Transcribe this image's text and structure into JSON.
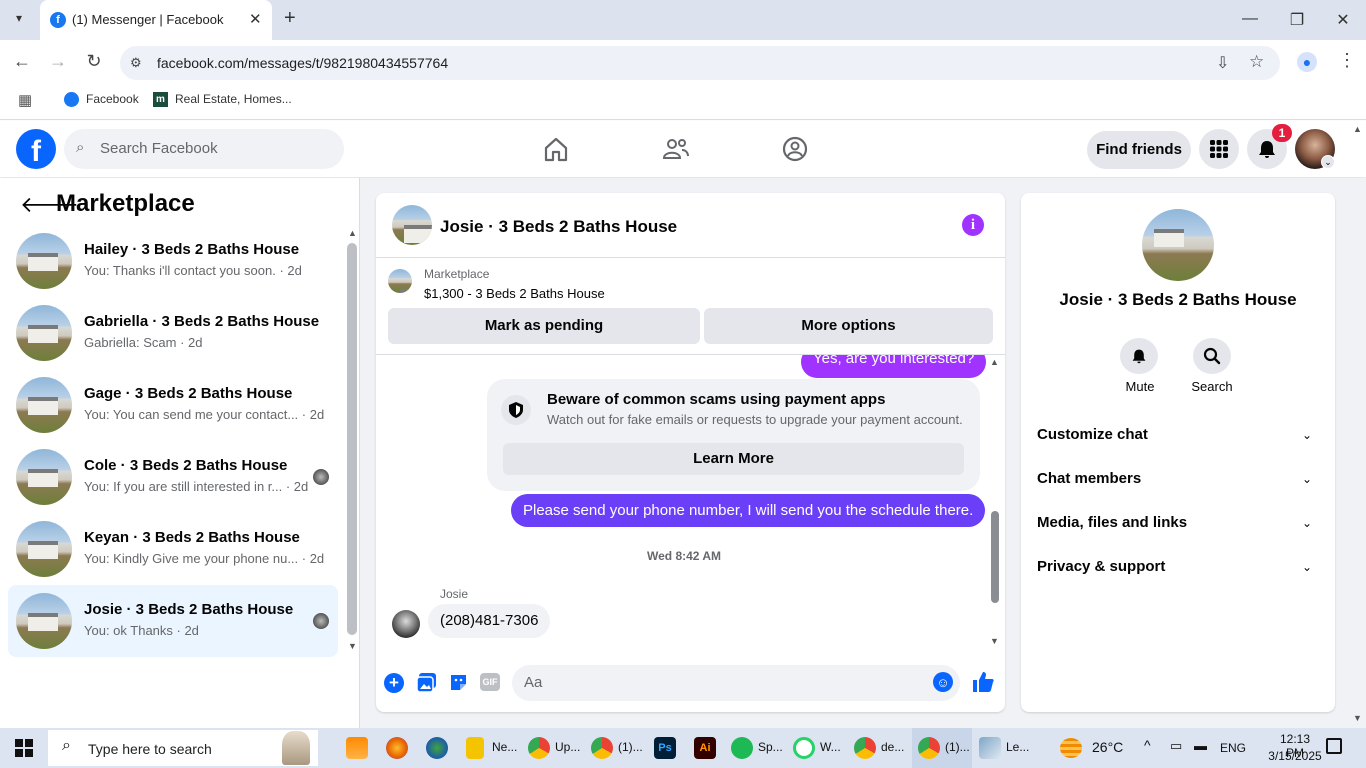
{
  "browser": {
    "tab_title": "(1) Messenger | Facebook",
    "url": "facebook.com/messages/t/9821980434557764",
    "bookmarks": [
      "Facebook",
      "Real Estate, Homes..."
    ]
  },
  "fb": {
    "search_placeholder": "Search Facebook",
    "find_friends": "Find friends",
    "notif_count": "1"
  },
  "sidebar": {
    "title": "Marketplace",
    "conversations": [
      {
        "name": "Hailey · 3 Beds 2 Baths House",
        "preview": "You: Thanks i'll contact you soon. · 2d"
      },
      {
        "name": "Gabriella · 3 Beds 2 Baths House",
        "preview": "Gabriella: Scam · 2d"
      },
      {
        "name": "Gage · 3 Beds 2 Baths House",
        "preview": "You: You can send me your contact... · 2d"
      },
      {
        "name": "Cole · 3 Beds 2 Baths House",
        "preview": "You: If you are still interested in r... · 2d"
      },
      {
        "name": "Keyan · 3 Beds 2 Baths House",
        "preview": "You: Kindly Give me your phone nu... · 2d"
      },
      {
        "name": "Josie · 3 Beds 2 Baths House",
        "preview": "You: ok Thanks · 2d"
      }
    ]
  },
  "chat": {
    "title": "Josie · 3 Beds 2 Baths House",
    "listing_source": "Marketplace",
    "listing_title": "$1,300 - 3 Beds 2 Baths House",
    "mark_pending": "Mark as pending",
    "more_options": "More options",
    "msg_partial": "Yes, are you interested?",
    "scam_title": "Beware of common scams using payment apps",
    "scam_body": "Watch out for fake emails or requests to upgrade your payment account.",
    "learn_more": "Learn More",
    "msg_out": "Please send your phone number, I will send you the schedule there.",
    "timestamp": "Wed 8:42 AM",
    "sender": "Josie",
    "msg_in": "(208)481-7306",
    "composer_placeholder": "Aa"
  },
  "details": {
    "title": "Josie · 3 Beds 2 Baths House",
    "mute": "Mute",
    "search": "Search",
    "sections": [
      "Customize chat",
      "Chat members",
      "Media, files and links",
      "Privacy & support"
    ]
  },
  "taskbar": {
    "search_placeholder": "Type here to search",
    "apps": [
      "Ne...",
      "Up...",
      "(1)...",
      "Sp...",
      "W...",
      "de...",
      "(1)...",
      "Le..."
    ],
    "temp": "26°C",
    "lang": "ENG",
    "time": "12:13 PM",
    "date": "3/15/2025"
  },
  "colors": {
    "fb_blue": "#0866ff",
    "outgoing_bubble": "#a033ff",
    "accent_purple": "#a033ff",
    "taskbar": "#dbe4f0"
  }
}
